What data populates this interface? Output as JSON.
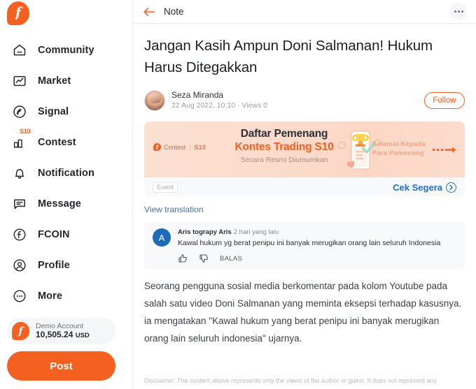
{
  "brand": {
    "logo_letter": "f",
    "accent": "#f4601f"
  },
  "sidebar": {
    "items": [
      {
        "label": "Community",
        "icon": "home-icon"
      },
      {
        "label": "Market",
        "icon": "chart-box-icon"
      },
      {
        "label": "Signal",
        "icon": "signal-icon"
      },
      {
        "label": "Contest",
        "icon": "bar-chart-icon",
        "badge": "S10"
      },
      {
        "label": "Notification",
        "icon": "bell-icon"
      },
      {
        "label": "Message",
        "icon": "message-icon"
      },
      {
        "label": "FCOIN",
        "icon": "fcoin-icon"
      },
      {
        "label": "Profile",
        "icon": "person-icon"
      },
      {
        "label": "More",
        "icon": "more-dots-icon"
      }
    ],
    "account": {
      "name": "Demo Account",
      "balance": "10,505.24",
      "currency": "USD",
      "logo_letter": "f"
    },
    "post_button": "Post"
  },
  "topbar": {
    "back_icon": "back-arrow-icon",
    "title": "Note",
    "more_icon": "more-dots-icon"
  },
  "note": {
    "title": "Jangan Kasih Ampun Doni Salmanan! Hukum Harus Ditegakkan",
    "author": {
      "name": "Seza Miranda",
      "meta": "22 Aug 2022, 10:10 · Views 0"
    },
    "follow_button": "Follow",
    "banner": {
      "chip_label": "Contest",
      "chip_tag": "S10",
      "line1": "Daftar Pemenang",
      "line2": "Kontes Trading S10",
      "line3": "Secara Resmi Diumumkan",
      "right_line1": "Selamat Kepada",
      "right_line2": "Para Pemenang",
      "event_tag": "Event",
      "cta": "Cek Segera",
      "cta_icon": "chevron-right-circle-icon"
    },
    "view_translation": "View translation",
    "comment": {
      "avatar_letter": "A",
      "author": "Aris tograpy Aris",
      "time": "2 hari yang lalu",
      "text": "Kawal hukum yg berat penipu ini banyak merugikan orang lain seluruh Indonesia",
      "like_icon": "thumbs-up-icon",
      "dislike_icon": "thumbs-down-icon",
      "reply_label": "BALAS"
    },
    "body": "Seorang pengguna sosial media berkomentar pada kolom Youtube pada salah satu video Doni Salmanan yang meminta eksepsi terhadap kasusnya. ia mengatakan \"Kawal hukum yang berat penipu ini banyak merugikan orang lain seluruh indonesia\" ujarnya.",
    "disclaimer": "Disclaimer: The content above represents only the views of the author or guest. It does not represent any"
  }
}
